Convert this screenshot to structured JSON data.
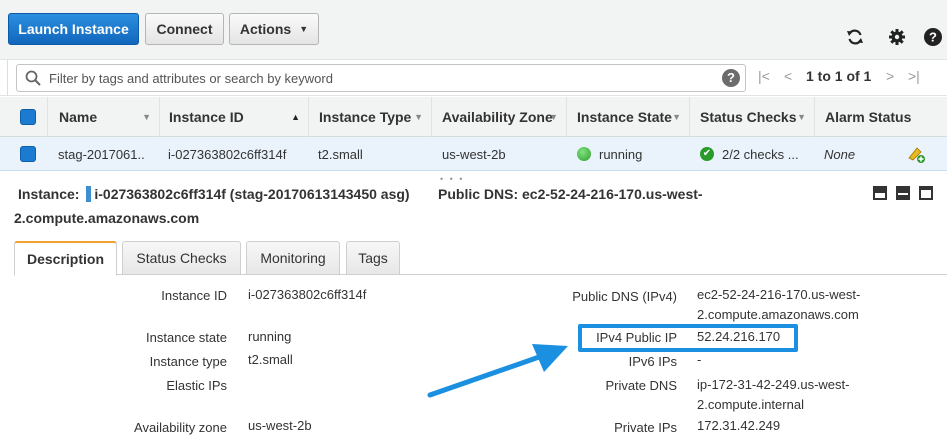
{
  "toolbar": {
    "launch_label": "Launch Instance",
    "connect_label": "Connect",
    "actions_label": "Actions",
    "actions_caret": "▼"
  },
  "filter": {
    "placeholder": "Filter by tags and attributes or search by keyword",
    "help_glyph": "?",
    "pager_text": "1 to 1 of 1"
  },
  "table": {
    "columns": [
      "Name",
      "Instance ID",
      "Instance Type",
      "Availability Zone",
      "Instance State",
      "Status Checks",
      "Alarm Status"
    ],
    "rows": [
      {
        "name": "stag-2017061..",
        "instance_id": "i-027363802c6ff314f",
        "instance_type": "t2.small",
        "availability_zone": "us-west-2b",
        "instance_state": "running",
        "status_checks": "2/2 checks ...",
        "alarm_status": "None"
      }
    ]
  },
  "detail": {
    "instance_label": "Instance:",
    "instance_value": "i-027363802c6ff314f (stag-20170613143450 asg)",
    "public_dns_label": "Public DNS:",
    "public_dns_value_line1": "ec2-52-24-216-170.us-west-",
    "public_dns_value_line2": "2.compute.amazonaws.com"
  },
  "tabs": [
    "Description",
    "Status Checks",
    "Monitoring",
    "Tags"
  ],
  "description": {
    "left": [
      {
        "label": "Instance ID",
        "value": "i-027363802c6ff314f"
      },
      {
        "label": "Instance state",
        "value": "running"
      },
      {
        "label": "Instance type",
        "value": "t2.small"
      },
      {
        "label": "Elastic IPs",
        "value": ""
      },
      {
        "label": "Availability zone",
        "value": "us-west-2b"
      }
    ],
    "right": [
      {
        "label": "Public DNS (IPv4)",
        "value_line1": "ec2-52-24-216-170.us-west-",
        "value_line2": "2.compute.amazonaws.com"
      },
      {
        "label": "IPv4 Public IP",
        "value": "52.24.216.170"
      },
      {
        "label": "IPv6 IPs",
        "value": "-"
      },
      {
        "label": "Private DNS",
        "value_line1": "ip-172-31-42-249.us-west-",
        "value_line2": "2.compute.internal"
      },
      {
        "label": "Private IPs",
        "value": "172.31.42.249"
      }
    ]
  },
  "colors": {
    "primary_button": "#1166bb",
    "highlight": "#1b8fe0",
    "running_green": "#3cb43c",
    "tab_accent": "#f0a32f"
  },
  "icons": [
    "search-icon",
    "help-icon",
    "refresh-icon",
    "gear-icon",
    "help-circle-icon",
    "first-page-icon",
    "prev-page-icon",
    "next-page-icon",
    "last-page-icon",
    "status-running-icon",
    "check-icon",
    "create-alarm-icon",
    "annotation-arrow"
  ]
}
